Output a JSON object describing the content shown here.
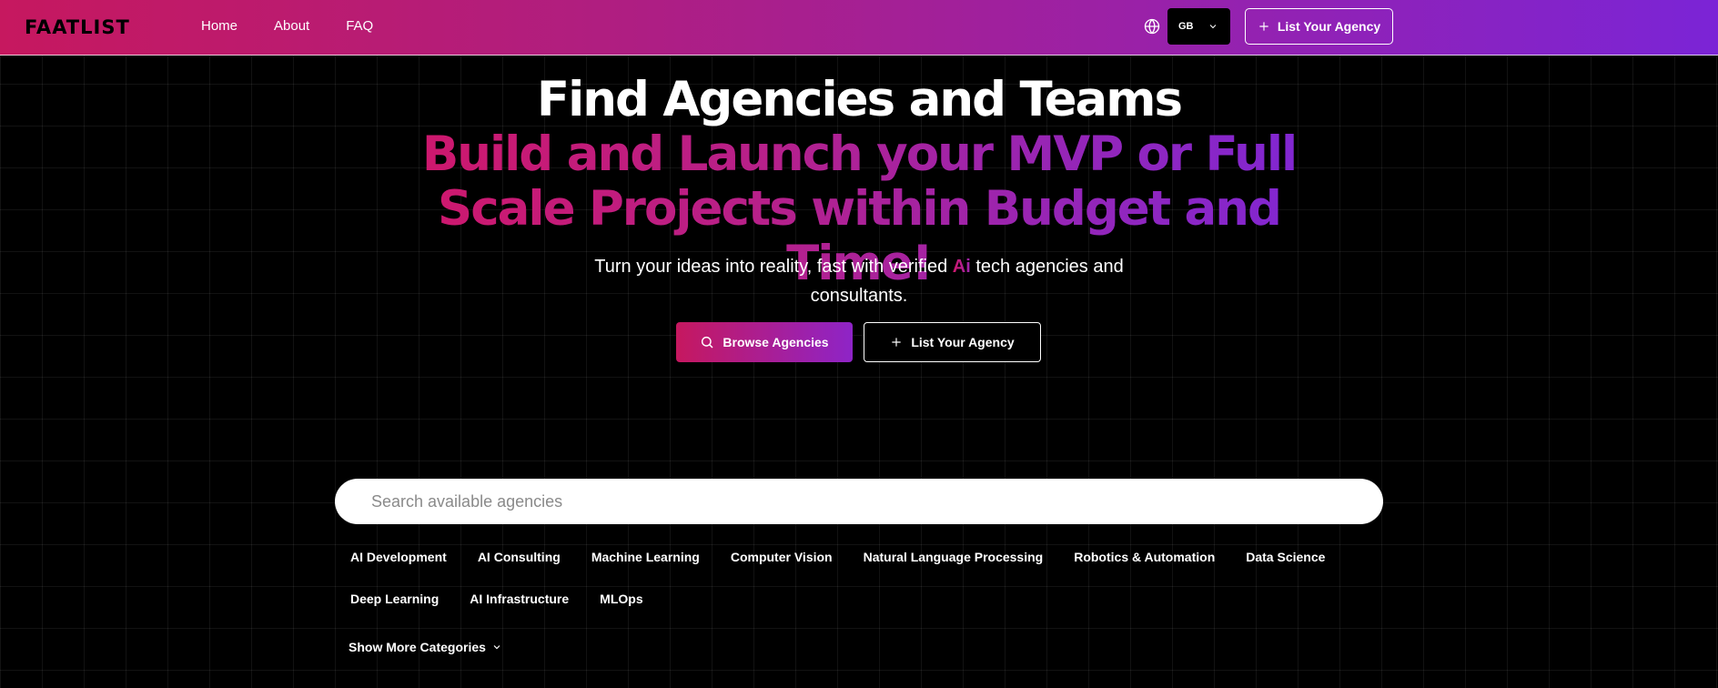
{
  "header": {
    "logo": "FAATLIST",
    "nav": [
      "Home",
      "About",
      "FAQ"
    ],
    "language": "GB",
    "cta_label": "List Your Agency"
  },
  "hero": {
    "title": "Find Agencies and Teams",
    "subtitle_line1": "Build and Launch your MVP or Full",
    "subtitle_line2": "Scale Projects within Budget and Time!",
    "desc_before": "Turn your ideas into reality, fast with verified ",
    "desc_ai": "Ai",
    "desc_after": " tech agencies and consultants.",
    "browse_label": "Browse Agencies",
    "list_label": "List Your Agency"
  },
  "search": {
    "placeholder": "Search available agencies"
  },
  "categories": [
    "AI Development",
    "AI Consulting",
    "Machine Learning",
    "Computer Vision",
    "Natural Language Processing",
    "Robotics & Automation",
    "Data Science",
    "Deep Learning",
    "AI Infrastructure",
    "MLOps"
  ],
  "show_more_label": "Show More Categories",
  "colors": {
    "brand_pink": "#c6185f",
    "brand_purple": "#7b24d6",
    "background": "#000000"
  }
}
